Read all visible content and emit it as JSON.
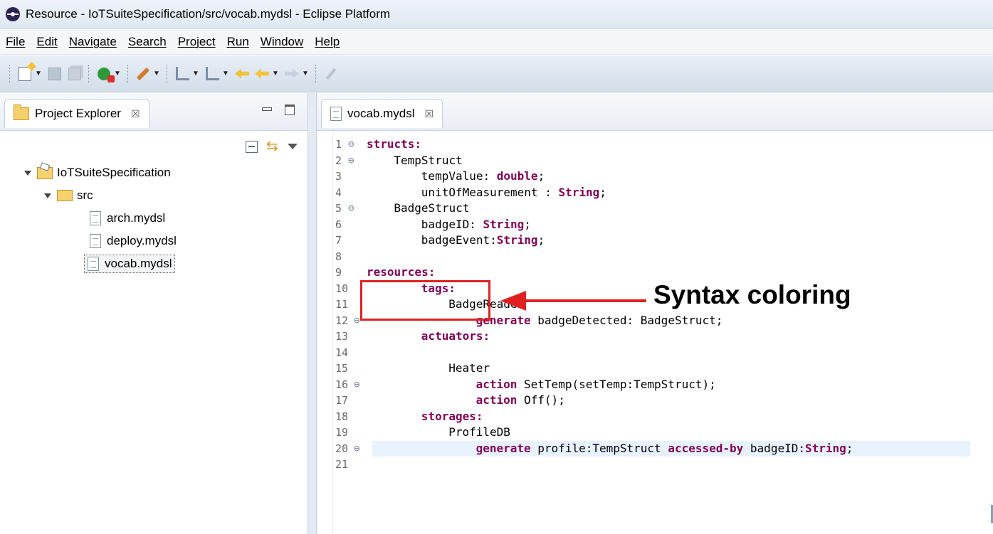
{
  "window": {
    "title": "Resource - IoTSuiteSpecification/src/vocab.mydsl - Eclipse Platform"
  },
  "menu": [
    "File",
    "Edit",
    "Navigate",
    "Search",
    "Project",
    "Run",
    "Window",
    "Help"
  ],
  "toolbar": {
    "icons": [
      "new-icon",
      "save-icon",
      "save-all-icon",
      "run-icon",
      "annotation-icon",
      "next-annotation-icon",
      "prev-annotation-icon",
      "last-edit-icon",
      "back-icon",
      "forward-icon",
      "pin-icon"
    ]
  },
  "explorer": {
    "tab_label": "Project Explorer",
    "close_glyph": "☒",
    "tree": [
      {
        "label": "IoTSuiteSpecification",
        "level": 0,
        "type": "project"
      },
      {
        "label": "src",
        "level": 1,
        "type": "folder"
      },
      {
        "label": "arch.mydsl",
        "level": 2,
        "type": "file"
      },
      {
        "label": "deploy.mydsl",
        "level": 2,
        "type": "file"
      },
      {
        "label": "vocab.mydsl",
        "level": 2,
        "type": "file",
        "selected": true
      }
    ]
  },
  "editor": {
    "tab_label": "vocab.mydsl",
    "close_glyph": "☒",
    "current_line": 20,
    "lines": [
      {
        "n": "1",
        "fold": true,
        "indent": 0,
        "parts": [
          [
            "kw",
            "structs:"
          ]
        ]
      },
      {
        "n": "2",
        "fold": true,
        "indent": 4,
        "parts": [
          [
            "t",
            "TempStruct"
          ]
        ]
      },
      {
        "n": "3",
        "fold": false,
        "indent": 8,
        "parts": [
          [
            "t",
            "tempValue: "
          ],
          [
            "kw",
            "double"
          ],
          [
            "t",
            ";"
          ]
        ]
      },
      {
        "n": "4",
        "fold": false,
        "indent": 8,
        "parts": [
          [
            "t",
            "unitOfMeasurement : "
          ],
          [
            "kw",
            "String"
          ],
          [
            "t",
            ";"
          ]
        ]
      },
      {
        "n": "5",
        "fold": true,
        "indent": 4,
        "parts": [
          [
            "t",
            "BadgeStruct"
          ]
        ]
      },
      {
        "n": "6",
        "fold": false,
        "indent": 8,
        "parts": [
          [
            "t",
            "badgeID: "
          ],
          [
            "kw",
            "String"
          ],
          [
            "t",
            ";"
          ]
        ]
      },
      {
        "n": "7",
        "fold": false,
        "indent": 8,
        "parts": [
          [
            "t",
            "badgeEvent:"
          ],
          [
            "kw",
            "String"
          ],
          [
            "t",
            ";"
          ]
        ]
      },
      {
        "n": "8",
        "fold": false,
        "indent": 0,
        "parts": []
      },
      {
        "n": "9",
        "fold": false,
        "indent": 0,
        "parts": [
          [
            "kw",
            "resources:"
          ]
        ]
      },
      {
        "n": "10",
        "fold": false,
        "indent": 8,
        "parts": [
          [
            "kw",
            "tags:"
          ]
        ]
      },
      {
        "n": "11",
        "fold": false,
        "indent": 12,
        "parts": [
          [
            "t",
            "BadgeReader"
          ]
        ]
      },
      {
        "n": "12",
        "fold": true,
        "indent": 16,
        "parts": [
          [
            "kw",
            "generate"
          ],
          [
            "t",
            " badgeDetected: BadgeStruct;"
          ]
        ]
      },
      {
        "n": "13",
        "fold": false,
        "indent": 8,
        "parts": [
          [
            "kw",
            "actuators:"
          ]
        ]
      },
      {
        "n": "14",
        "fold": false,
        "indent": 0,
        "parts": []
      },
      {
        "n": "15",
        "fold": false,
        "indent": 12,
        "parts": [
          [
            "t",
            "Heater"
          ]
        ]
      },
      {
        "n": "16",
        "fold": true,
        "indent": 16,
        "parts": [
          [
            "kw",
            "action"
          ],
          [
            "t",
            " SetTemp(setTemp:TempStruct);"
          ]
        ]
      },
      {
        "n": "17",
        "fold": false,
        "indent": 16,
        "parts": [
          [
            "kw",
            "action"
          ],
          [
            "t",
            " Off();"
          ]
        ]
      },
      {
        "n": "18",
        "fold": false,
        "indent": 8,
        "parts": [
          [
            "kw",
            "storages:"
          ]
        ]
      },
      {
        "n": "19",
        "fold": false,
        "indent": 12,
        "parts": [
          [
            "t",
            "ProfileDB"
          ]
        ]
      },
      {
        "n": "20",
        "fold": true,
        "indent": 16,
        "parts": [
          [
            "kw",
            "generate"
          ],
          [
            "t",
            " profile:TempStruct "
          ],
          [
            "kw",
            "accessed-by"
          ],
          [
            "t",
            " badgeID:"
          ],
          [
            "kw",
            "String"
          ],
          [
            "t",
            ";"
          ]
        ]
      },
      {
        "n": "21",
        "fold": false,
        "indent": 0,
        "parts": []
      }
    ]
  },
  "annotation": {
    "text": "Syntax coloring",
    "color": "#e02020"
  },
  "colors": {
    "keyword": "#7f0055",
    "current_line": "#e8f2fe"
  }
}
